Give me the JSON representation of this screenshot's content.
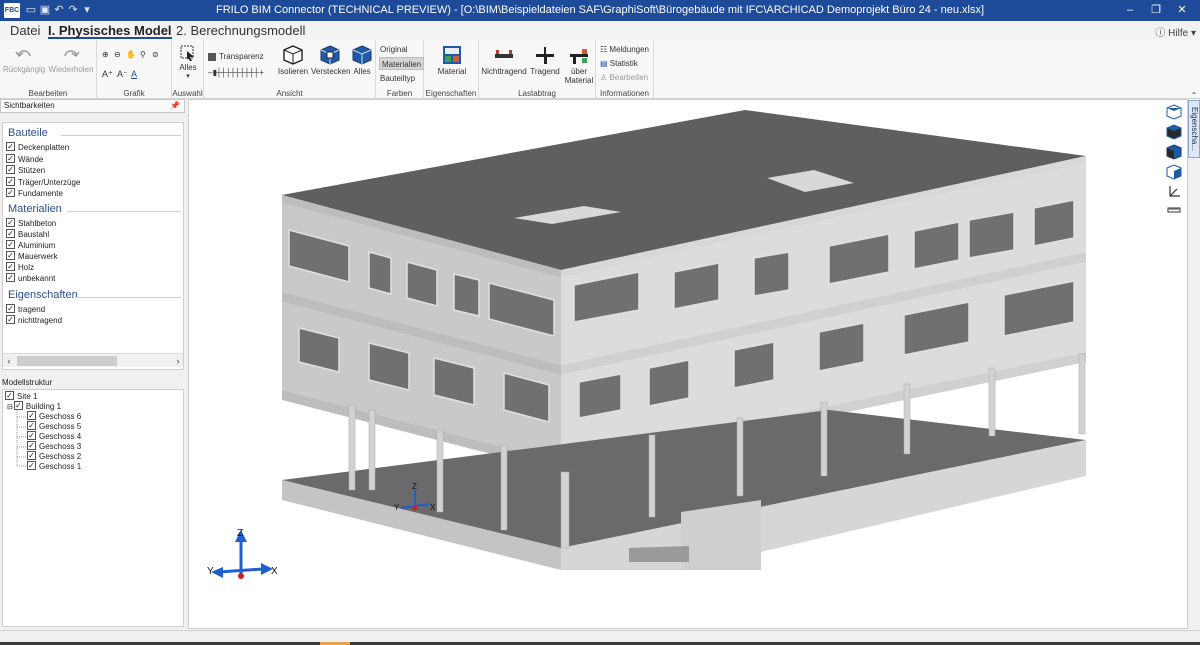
{
  "titlebar": {
    "app_icon": "FBC",
    "title": "FRILO BIM Connector (TECHNICAL PREVIEW)  -  [O:\\BIM\\Beispieldateien SAF\\GraphiSoft\\Bürogebäude mit IFC\\ARCHICAD Demoprojekt Büro 24 - neu.xlsx]",
    "qat_icons": [
      "folder-icon",
      "save-icon",
      "undo-icon",
      "redo-icon",
      "dropdown-icon"
    ],
    "minimize": "–",
    "restore": "❐",
    "close": "✕"
  },
  "tabs": {
    "file": "Datei",
    "physical": "I. Physisches Model",
    "calc": "2. Berechnungsmodell",
    "help": "Hilfe"
  },
  "ribbon": {
    "bearbeiten": {
      "label": "Bearbeiten",
      "undo": "Rückgängig",
      "redo": "Wiederholen"
    },
    "grafik": {
      "label": "Grafik"
    },
    "auswahl": {
      "label": "Auswahl",
      "all": "Alles"
    },
    "ansicht": {
      "label": "Ansicht",
      "transparency": "Transparenz",
      "isolate": "Isolieren",
      "hide": "Verstecken",
      "all": "Alles"
    },
    "farben": {
      "label": "Farben",
      "original": "Original",
      "materials": "Materialien",
      "component_type": "Bauteiltyp"
    },
    "eigenschaften": {
      "label": "Eigenschaften",
      "material": "Material"
    },
    "lastabtrag": {
      "label": "Lastabtrag",
      "non_load": "Nichttragend",
      "load": "Tragend",
      "over": "über",
      "over2": "Material"
    },
    "informationen": {
      "label": "Informationen",
      "messages": "Meldungen",
      "statistics": "Statistik",
      "edit": "Bearbeiten"
    }
  },
  "visibility": {
    "header": "Sichtbarkeiten",
    "bauteile_title": "Bauteile",
    "bauteile": [
      "Deckenplatten",
      "Wände",
      "Stützen",
      "Träger/Unterzüge",
      "Fundamente"
    ],
    "materialien_title": "Materialien",
    "materialien": [
      "Stahlbeton",
      "Baustahl",
      "Aluminium",
      "Mauerwerk",
      "Holz",
      "unbekannt"
    ],
    "eigenschaften_title": "Eigenschaften",
    "eigenschaften": [
      "tragend",
      "nichttragend"
    ]
  },
  "model_structure": {
    "header": "Modellstruktur",
    "site": "Site 1",
    "building": "Building 1",
    "storeys": [
      "Geschoss 6",
      "Geschoss 5",
      "Geschoss 4",
      "Geschoss 3",
      "Geschoss 2",
      "Geschoss 1"
    ]
  },
  "viewport": {
    "axis_z": "Z",
    "axis_y": "Y",
    "axis_x": "X",
    "colors": {
      "roof": "#5f5f5f",
      "wall_front": "#d6d6d6",
      "wall_side": "#c4c4c4",
      "slab_dark": "#666666",
      "axis_x": "#1f5fd1",
      "axis_z": "#1f5fd1",
      "origin": "#d01f1f"
    }
  },
  "right_panel": {
    "properties_tab": "Eigenscha..."
  }
}
